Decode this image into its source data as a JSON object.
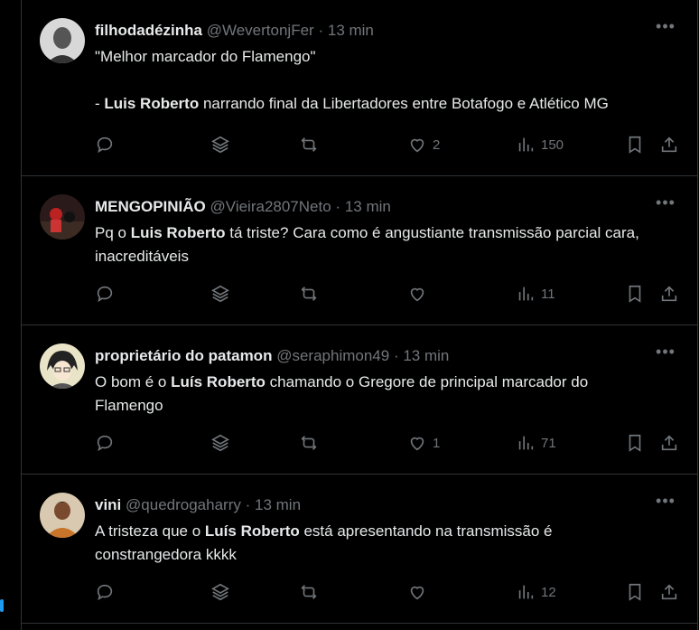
{
  "tweets": [
    {
      "display_name": "filhodadézinha",
      "handle": "@WevertonjFer",
      "time": "13 min",
      "lines": [
        "\"Melhor marcador do Flamengo\""
      ],
      "line2_pre": "- ",
      "line2_bold": "Luis Roberto",
      "line2_post": " narrando final da Libertadores entre Botafogo e Atlético MG",
      "likes": "2",
      "views": "150"
    },
    {
      "display_name": "MENGOPINIÃO",
      "handle": "@Vieira2807Neto",
      "time": "13 min",
      "pre": "Pq o ",
      "bold": "Luis Roberto",
      "post": " tá triste? Cara como é angustiante transmissão parcial cara,",
      "line2": "inacreditáveis",
      "likes": "",
      "views": "11"
    },
    {
      "display_name": "proprietário do patamon",
      "handle": "@seraphimon49",
      "time": "13 min",
      "pre": "O bom é o ",
      "bold": "Luís Roberto",
      "post": " chamando o Gregore de principal marcador do",
      "line2": "Flamengo",
      "likes": "1",
      "views": "71"
    },
    {
      "display_name": "vini",
      "handle": "@quedrogaharry",
      "time": "13 min",
      "pre": "A tristeza que o ",
      "bold": "Luís Roberto",
      "post": " está apresentando na transmissão é",
      "line2": "constrangedora kkkk",
      "likes": "",
      "views": "12"
    }
  ],
  "separator": "·",
  "more_glyph": "•••",
  "icons": [
    "reply-icon",
    "grok-icon",
    "retweet-icon",
    "like-icon",
    "views-icon",
    "bookmark-icon",
    "share-icon"
  ]
}
